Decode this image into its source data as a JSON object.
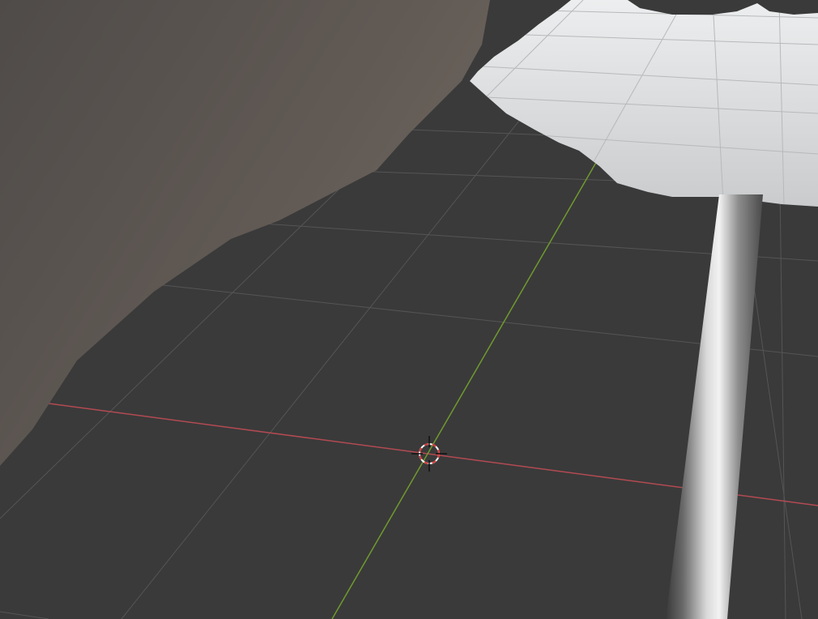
{
  "app": {
    "name": "3D viewport"
  },
  "viewport": {
    "background_color": "#3a3a3a",
    "grid_color": "#555555",
    "x_axis_color": "#b34a52",
    "y_axis_color": "#6f9a2e",
    "cursor_ring_colors": [
      "#d83a3a",
      "#ffffff"
    ],
    "objects": {
      "wall_color": "#5f5853",
      "plane_color": "#d8d9db",
      "pole_color": "#8a8a8a"
    }
  }
}
